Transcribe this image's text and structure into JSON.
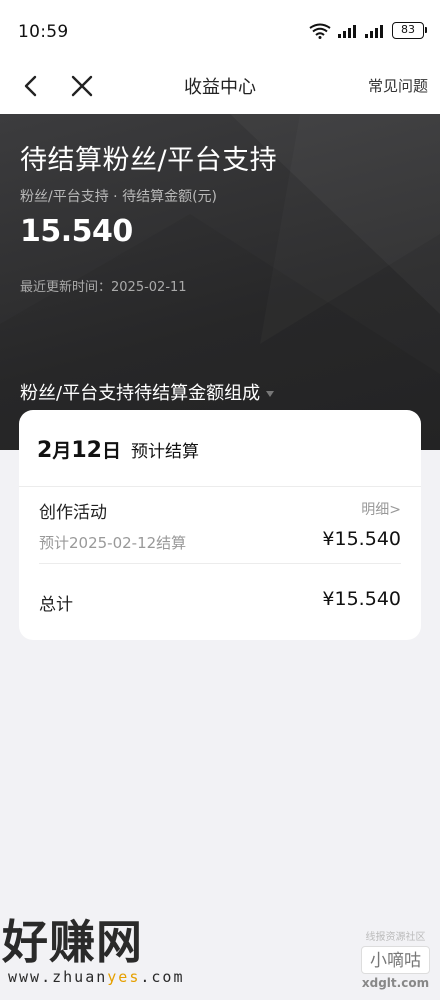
{
  "status_bar": {
    "time": "10:59",
    "battery": "83"
  },
  "nav": {
    "title": "收益中心",
    "faq": "常见问题"
  },
  "hero": {
    "title": "待结算粉丝/平台支持",
    "subtitle": "粉丝/平台支持 · 待结算金额(元)",
    "amount": "15.540",
    "updated_label": "最近更新时间：",
    "updated_value": "2025-02-11",
    "breakdown_label": "粉丝/平台支持待结算金额组成"
  },
  "card": {
    "date_day_month": "2",
    "date_month_suffix": "月",
    "date_day": "12",
    "date_day_suffix": "日",
    "settle_label": "预计结算",
    "activity": {
      "name": "创作活动",
      "detail_link": "明细>",
      "expected": "预计2025-02-12结算",
      "amount": "¥15.540"
    },
    "total": {
      "label": "总计",
      "amount": "¥15.540"
    }
  },
  "watermarks": {
    "left_big": "好赚网",
    "left_url_a": "www.zhuan",
    "left_url_hl": "yes",
    "left_url_b": ".com",
    "right_small": "线报资源社区",
    "right_box": "小嘀咕",
    "right_url": "xdglt.com"
  },
  "colors": {
    "hero_bg": "#2b2b2c",
    "page_bg": "#f2f2f5",
    "card_bg": "#ffffff"
  }
}
